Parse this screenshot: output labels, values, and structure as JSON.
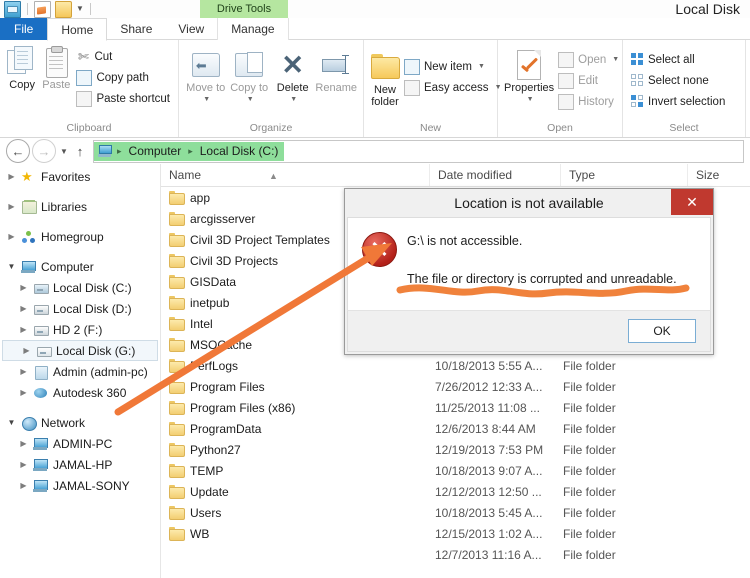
{
  "window": {
    "title": "Local Disk",
    "contextual_tab": "Drive Tools",
    "quick_access": [
      "explorer-icon",
      "properties-icon",
      "new-folder-icon",
      "dropdown-caret"
    ]
  },
  "ribbon": {
    "tabs": [
      {
        "label": "File",
        "kind": "file"
      },
      {
        "label": "Home",
        "kind": "active"
      },
      {
        "label": "Share",
        "kind": "normal"
      },
      {
        "label": "View",
        "kind": "normal"
      },
      {
        "label": "Manage",
        "kind": "contextual"
      }
    ],
    "groups": [
      {
        "label": "Clipboard",
        "big": [
          {
            "label": "Copy",
            "icon": "copy-icon",
            "disabled": false
          },
          {
            "label": "Paste",
            "icon": "paste-icon",
            "disabled": true
          }
        ],
        "small": [
          {
            "label": "Cut",
            "icon": "scissors-icon",
            "disabled": false
          },
          {
            "label": "Copy path",
            "icon": "copy-path-icon",
            "disabled": false
          },
          {
            "label": "Paste shortcut",
            "icon": "paste-shortcut-icon",
            "disabled": false
          }
        ]
      },
      {
        "label": "Organize",
        "big": [
          {
            "label": "Move to",
            "icon": "move-to-icon",
            "disabled": true,
            "caret": true
          },
          {
            "label": "Copy to",
            "icon": "copy-to-icon",
            "disabled": true,
            "caret": true
          },
          {
            "label": "Delete",
            "icon": "delete-icon",
            "disabled": false,
            "caret": true
          },
          {
            "label": "Rename",
            "icon": "rename-icon",
            "disabled": true
          }
        ],
        "small": []
      },
      {
        "label": "New",
        "big": [
          {
            "label": "New folder",
            "icon": "new-folder-icon",
            "disabled": false
          }
        ],
        "small": [
          {
            "label": "New item",
            "icon": "new-item-icon",
            "disabled": false,
            "caret": true
          },
          {
            "label": "Easy access",
            "icon": "easy-access-icon",
            "disabled": false,
            "caret": true
          }
        ]
      },
      {
        "label": "Open",
        "big": [
          {
            "label": "Properties",
            "icon": "properties-icon",
            "disabled": false,
            "caret": true
          }
        ],
        "small": [
          {
            "label": "Open",
            "icon": "open-icon",
            "disabled": true,
            "caret": true
          },
          {
            "label": "Edit",
            "icon": "edit-icon",
            "disabled": true
          },
          {
            "label": "History",
            "icon": "history-icon",
            "disabled": true
          }
        ]
      },
      {
        "label": "Select",
        "big": [],
        "small": [
          {
            "label": "Select all",
            "icon": "select-all-icon",
            "disabled": false
          },
          {
            "label": "Select none",
            "icon": "select-none-icon",
            "disabled": false
          },
          {
            "label": "Invert selection",
            "icon": "invert-selection-icon",
            "disabled": false
          }
        ]
      }
    ]
  },
  "address_bar": {
    "back": "←",
    "forward": "→",
    "recent_caret": "▼",
    "up": "↑",
    "breadcrumbs": [
      "Computer",
      "Local Disk (C:)"
    ],
    "separator": "▸"
  },
  "nav_pane": {
    "items": [
      {
        "label": "Favorites",
        "icon": "favorites-star-icon",
        "level": 0,
        "expander": "collapsed",
        "gap_after": true
      },
      {
        "label": "Libraries",
        "icon": "libraries-icon",
        "level": 0,
        "expander": "collapsed",
        "gap_after": true
      },
      {
        "label": "Homegroup",
        "icon": "homegroup-icon",
        "level": 0,
        "expander": "collapsed",
        "gap_after": true
      },
      {
        "label": "Computer",
        "icon": "computer-icon",
        "level": 0,
        "expander": "expanded"
      },
      {
        "label": "Local Disk (C:)",
        "icon": "drive-system-icon",
        "level": 1,
        "expander": "collapsed"
      },
      {
        "label": "Local Disk (D:)",
        "icon": "drive-icon",
        "level": 1,
        "expander": "collapsed"
      },
      {
        "label": "HD 2 (F:)",
        "icon": "drive-icon",
        "level": 1,
        "expander": "collapsed"
      },
      {
        "label": "Local Disk (G:)",
        "icon": "drive-removable-icon",
        "level": 1,
        "expander": "collapsed",
        "selected": true
      },
      {
        "label": "Admin (admin-pc)",
        "icon": "user-folder-icon",
        "level": 1,
        "expander": "collapsed"
      },
      {
        "label": "Autodesk 360",
        "icon": "autodesk-cloud-icon",
        "level": 1,
        "expander": "collapsed",
        "gap_after": true
      },
      {
        "label": "Network",
        "icon": "network-icon",
        "level": 0,
        "expander": "expanded"
      },
      {
        "label": "ADMIN-PC",
        "icon": "computer-icon",
        "level": 1,
        "expander": "collapsed"
      },
      {
        "label": "JAMAL-HP",
        "icon": "computer-icon",
        "level": 1,
        "expander": "collapsed"
      },
      {
        "label": "JAMAL-SONY",
        "icon": "computer-icon",
        "level": 1,
        "expander": "collapsed"
      }
    ]
  },
  "file_list": {
    "columns": [
      "Name",
      "Date modified",
      "Type",
      "Size"
    ],
    "sort_column": "Name",
    "sort_direction": "ascending",
    "rows": [
      {
        "name": "app",
        "date": "",
        "type": "",
        "size": ""
      },
      {
        "name": "arcgisserver",
        "date": "",
        "type": "",
        "size": ""
      },
      {
        "name": "Civil 3D Project Templates",
        "date": "",
        "type": "",
        "size": ""
      },
      {
        "name": "Civil 3D Projects",
        "date": "",
        "type": "",
        "size": ""
      },
      {
        "name": "GISData",
        "date": "",
        "type": "",
        "size": ""
      },
      {
        "name": "inetpub",
        "date": "",
        "type": "",
        "size": ""
      },
      {
        "name": "Intel",
        "date": "",
        "type": "",
        "size": ""
      },
      {
        "name": "MSOCache",
        "date": "",
        "type": "",
        "size": ""
      },
      {
        "name": "PerfLogs",
        "date": "10/18/2013 5:55 A...",
        "type": "File folder",
        "size": ""
      },
      {
        "name": "Program Files",
        "date": "7/26/2012 12:33 A...",
        "type": "File folder",
        "size": ""
      },
      {
        "name": "Program Files (x86)",
        "date": "11/25/2013 11:08 ...",
        "type": "File folder",
        "size": ""
      },
      {
        "name": "ProgramData",
        "date": "12/6/2013 8:44 AM",
        "type": "File folder",
        "size": ""
      },
      {
        "name": "Python27",
        "date": "12/19/2013 7:53 PM",
        "type": "File folder",
        "size": ""
      },
      {
        "name": "TEMP",
        "date": "10/18/2013 9:07 A...",
        "type": "File folder",
        "size": ""
      },
      {
        "name": "Update",
        "date": "12/12/2013 12:50 ...",
        "type": "File folder",
        "size": ""
      },
      {
        "name": "Users",
        "date": "10/18/2013 5:45 A...",
        "type": "File folder",
        "size": ""
      },
      {
        "name": "WB",
        "date": "12/15/2013 1:02 A...",
        "type": "File folder",
        "size": ""
      },
      {
        "name": "",
        "date": "12/7/2013 11:16 A...",
        "type": "File folder",
        "size": ""
      }
    ]
  },
  "dialog": {
    "title": "Location is not available",
    "close_label": "✕",
    "error_glyph": "✕",
    "message_line1": "G:\\ is not accessible.",
    "message_line2": "The file or directory is corrupted and unreadable.",
    "ok_label": "OK"
  },
  "annotations": {
    "arrow_color": "#f07838",
    "underline_color": "#f0823c",
    "description": "orange arrow from Local Disk (G:) to error icon; wavy underline under message"
  },
  "colors": {
    "file_tab_blue": "#1a6fc4",
    "contextual_green": "#b5e6a0",
    "breadcrumb_green": "#8ede9b",
    "close_red": "#c0392f",
    "accent_orange": "#f07838"
  }
}
